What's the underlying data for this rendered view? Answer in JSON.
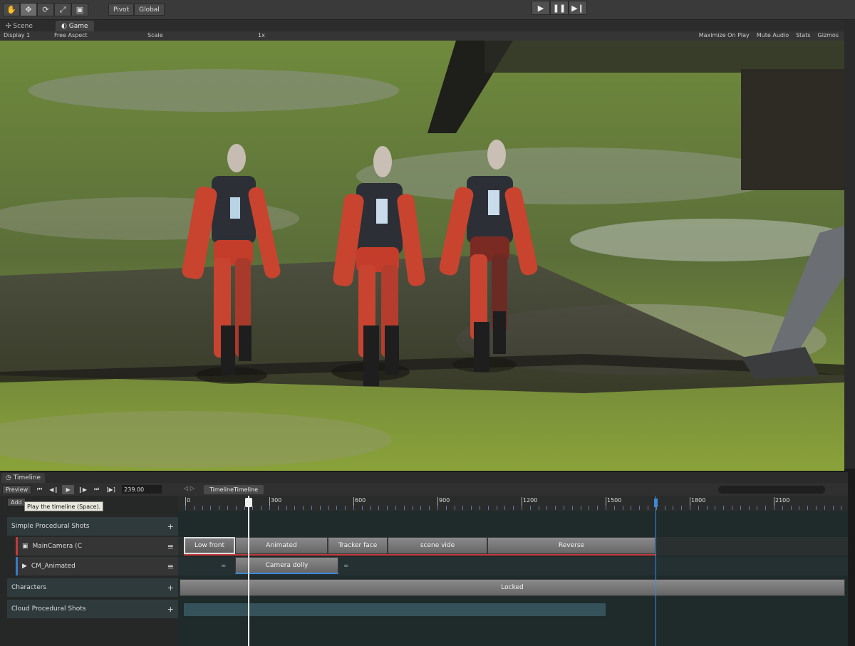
{
  "toolbar": {
    "pivot": "Pivot",
    "global": "Global"
  },
  "tabs": {
    "scene": "Scene",
    "game": "Game"
  },
  "gamebar": {
    "display": "Display 1",
    "aspect": "Free Aspect",
    "scale_label": "Scale",
    "scale_value": "1x",
    "maximize": "Maximize On Play",
    "mute": "Mute Audio",
    "stats": "Stats",
    "gizmos": "Gizmos"
  },
  "timeline": {
    "title": "Timeline",
    "preview": "Preview",
    "frame": "239.00",
    "breadcrumb": "TimelineTimeline",
    "add": "Add",
    "tooltip": "Play the timeline (Space).",
    "ruler_ticks": [
      {
        "label": "0",
        "pos": 0
      },
      {
        "label": "300",
        "pos": 1
      },
      {
        "label": "600",
        "pos": 2
      },
      {
        "label": "900",
        "pos": 3
      },
      {
        "label": "1200",
        "pos": 4
      },
      {
        "label": "1500",
        "pos": 5
      },
      {
        "label": "1800",
        "pos": 6
      },
      {
        "label": "2100",
        "pos": 7
      }
    ],
    "tracks": {
      "simple_group": "Simple Procedural Shots",
      "main_camera": "MainCamera (C",
      "cm_animated": "CM_Animated",
      "characters": "Characters",
      "cloud_group": "Cloud Procedural Shots"
    },
    "clips": {
      "low_front": "Low front",
      "animated": "Animated",
      "tracker_face": "Tracker face",
      "scene_wide": "scene vide",
      "reverse": "Reverse",
      "camera_dolly": "Camera dolly",
      "locked": "Locked"
    }
  }
}
